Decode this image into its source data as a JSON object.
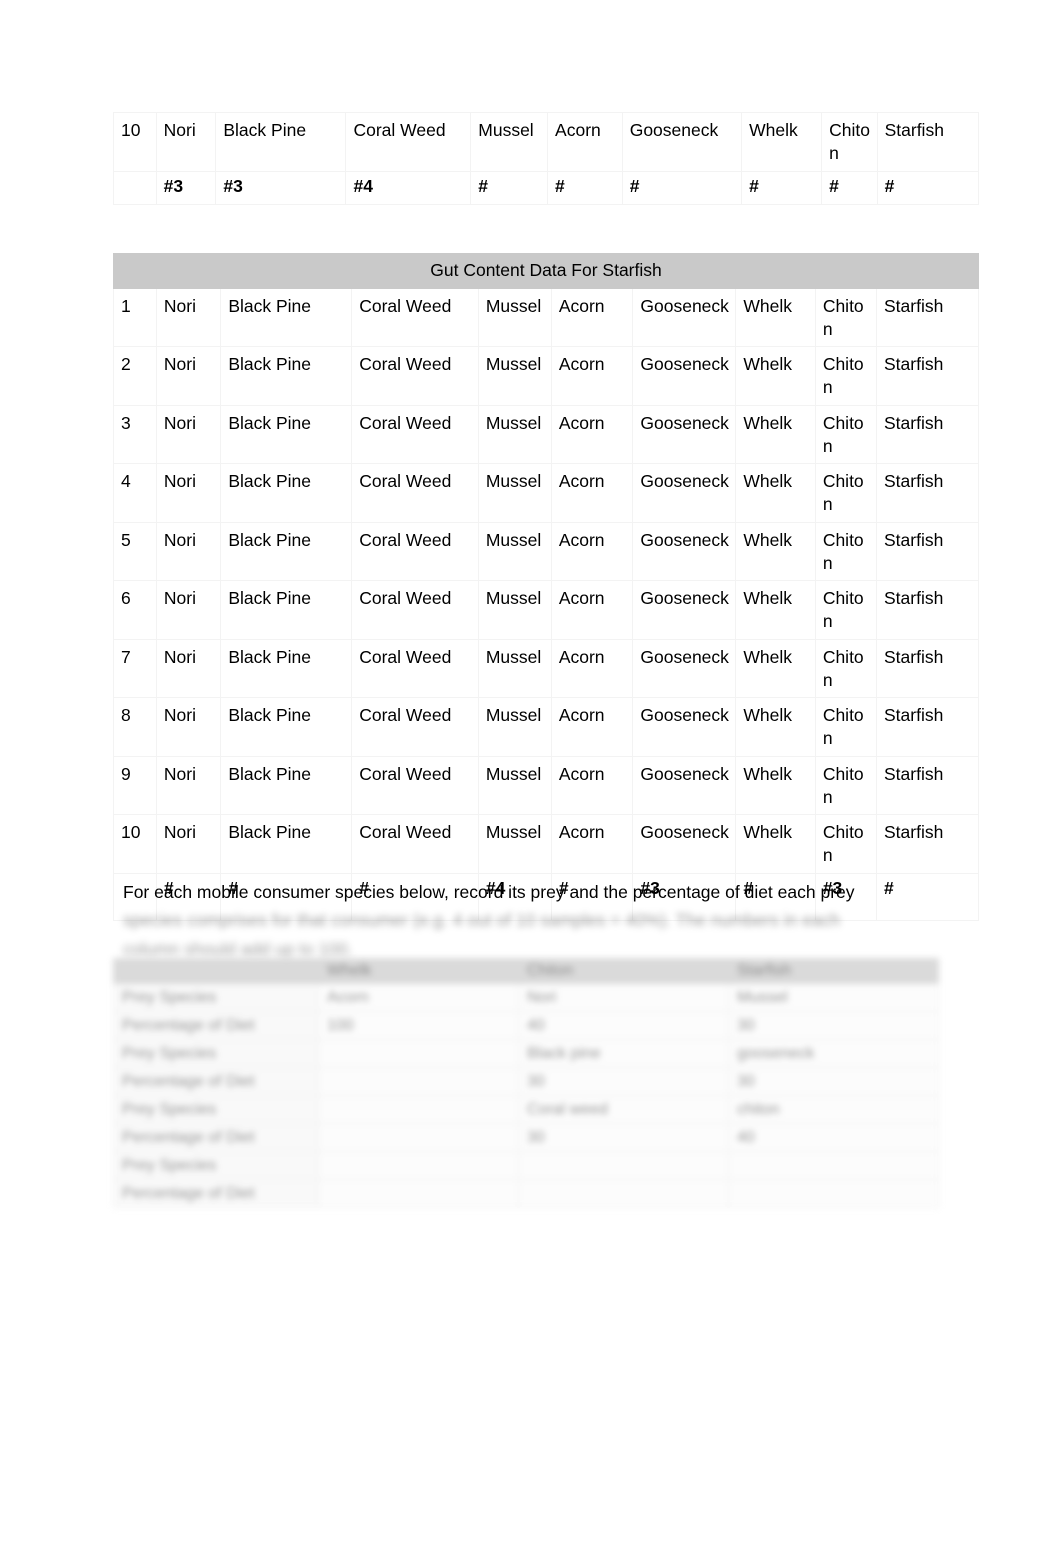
{
  "document": {
    "page_background": "#ffffff"
  },
  "table_one": {
    "name": "gut-content-table-partial",
    "note": "continuation rows of a preceding gut content table",
    "columns": [
      "",
      "Nori",
      "Black Pine",
      "Coral Weed",
      "Mussel",
      "Acorn",
      "Gooseneck",
      "Whelk",
      "Chiton",
      "Starfish"
    ],
    "rows": [
      {
        "number": "10",
        "cells": [
          "Nori",
          "Black Pine",
          "Coral Weed",
          "Mussel",
          "Acorn",
          "Gooseneck",
          "Whelk",
          "Chiton",
          "Starfish"
        ]
      }
    ],
    "tally_row": {
      "number": "",
      "cells": [
        "#3",
        "#3",
        "#4",
        "#",
        "#",
        "#",
        "#",
        "#",
        "#"
      ]
    }
  },
  "table_two": {
    "name": "gut-content-table-starfish",
    "caption": "Gut Content Data For Starfish",
    "caption_background": "#c9c9c9",
    "prey_columns": [
      "Nori",
      "Black Pine",
      "Coral Weed",
      "Mussel",
      "Acorn",
      "Gooseneck",
      "Whelk",
      "Chiton",
      "Starfish"
    ],
    "rows": [
      {
        "number": "1",
        "cells": [
          "Nori",
          "Black Pine",
          "Coral Weed",
          "Mussel",
          "Acorn",
          "Gooseneck",
          "Whelk",
          "Chiton",
          "Starfish"
        ]
      },
      {
        "number": "2",
        "cells": [
          "Nori",
          "Black Pine",
          "Coral Weed",
          "Mussel",
          "Acorn",
          "Gooseneck",
          "Whelk",
          "Chiton",
          "Starfish"
        ]
      },
      {
        "number": "3",
        "cells": [
          "Nori",
          "Black Pine",
          "Coral Weed",
          "Mussel",
          "Acorn",
          "Gooseneck",
          "Whelk",
          "Chiton",
          "Starfish"
        ]
      },
      {
        "number": "4",
        "cells": [
          "Nori",
          "Black Pine",
          "Coral Weed",
          "Mussel",
          "Acorn",
          "Gooseneck",
          "Whelk",
          "Chiton",
          "Starfish"
        ]
      },
      {
        "number": "5",
        "cells": [
          "Nori",
          "Black Pine",
          "Coral Weed",
          "Mussel",
          "Acorn",
          "Gooseneck",
          "Whelk",
          "Chiton",
          "Starfish"
        ]
      },
      {
        "number": "6",
        "cells": [
          "Nori",
          "Black Pine",
          "Coral Weed",
          "Mussel",
          "Acorn",
          "Gooseneck",
          "Whelk",
          "Chiton",
          "Starfish"
        ]
      },
      {
        "number": "7",
        "cells": [
          "Nori",
          "Black Pine",
          "Coral Weed",
          "Mussel",
          "Acorn",
          "Gooseneck",
          "Whelk",
          "Chiton",
          "Starfish"
        ]
      },
      {
        "number": "8",
        "cells": [
          "Nori",
          "Black Pine",
          "Coral Weed",
          "Mussel",
          "Acorn",
          "Gooseneck",
          "Whelk",
          "Chiton",
          "Starfish"
        ]
      },
      {
        "number": "9",
        "cells": [
          "Nori",
          "Black Pine",
          "Coral Weed",
          "Mussel",
          "Acorn",
          "Gooseneck",
          "Whelk",
          "Chiton",
          "Starfish"
        ]
      },
      {
        "number": "10",
        "cells": [
          "Nori",
          "Black Pine",
          "Coral Weed",
          "Mussel",
          "Acorn",
          "Gooseneck",
          "Whelk",
          "Chiton",
          "Starfish"
        ]
      }
    ],
    "tally_row": {
      "number": "",
      "cells": [
        "#",
        "#",
        "#",
        "#4",
        "#",
        "#3",
        "#",
        "#3",
        "#"
      ]
    }
  },
  "instruction": {
    "line1": "For each mobile consumer species below, record its prey and the percentage of diet each prey",
    "line2_obscured": "species comprises for that consumer (e.g. 4 out of 10 samples = 40%). The numbers in each",
    "line3_obscured": "column should add up to 100."
  },
  "diet_table": {
    "name": "diet-percentage-table",
    "obscured": true,
    "header": [
      "",
      "Whelk",
      "Chiton",
      "Starfish"
    ],
    "rows": [
      {
        "label": "Prey Species",
        "cells": [
          "Acorn",
          "Nori",
          "Mussel"
        ]
      },
      {
        "label": "Percentage of Diet",
        "cells": [
          "100",
          "40",
          "30"
        ]
      },
      {
        "label": "Prey Species",
        "cells": [
          "",
          "Black pine",
          "gooseneck"
        ]
      },
      {
        "label": "Percentage of Diet",
        "cells": [
          "",
          "30",
          "30"
        ]
      },
      {
        "label": "Prey Species",
        "cells": [
          "",
          "Coral weed",
          "chiton"
        ]
      },
      {
        "label": "Percentage of Diet",
        "cells": [
          "",
          "30",
          "40"
        ]
      },
      {
        "label": "Prey Species",
        "cells": [
          "",
          "",
          ""
        ]
      },
      {
        "label": "Percentage of Diet",
        "cells": [
          "",
          "",
          ""
        ]
      }
    ]
  }
}
